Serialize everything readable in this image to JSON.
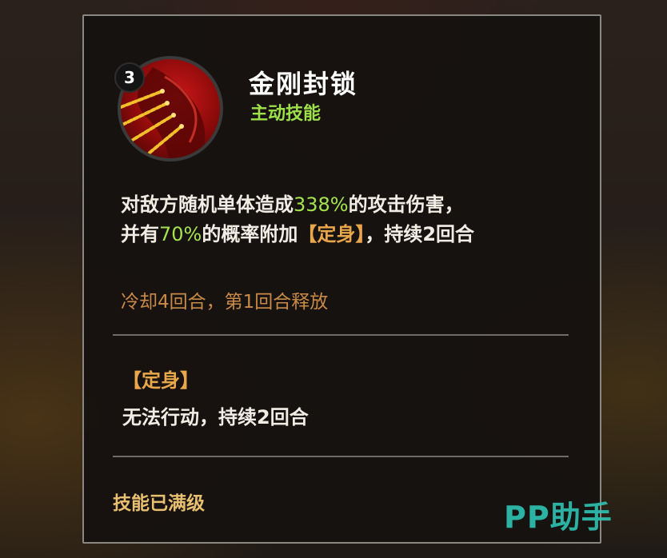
{
  "skill": {
    "level": "3",
    "name": "金刚封锁",
    "type": "主动技能",
    "desc_1": "对敌方随机单体造成",
    "damage_pct": "338%",
    "desc_2": "的攻击伤害，",
    "desc_3": "并有",
    "chance_pct": "70%",
    "desc_4": "的概率附加",
    "effect_tag": "【定身】",
    "desc_5": "，持续2回合",
    "cooldown": "冷却4回合，第1回合释放"
  },
  "status": {
    "title": "【定身】",
    "desc": "无法行动，持续2回合"
  },
  "footer": {
    "max_level": "技能已满级"
  },
  "watermark": {
    "text": "PP助手"
  },
  "colors": {
    "highlight_green": "#a6e24e",
    "highlight_orange": "#e9a64a",
    "watermark": "#2fc4b4"
  },
  "icons": {
    "skill_icon": "chained-hand-icon"
  }
}
